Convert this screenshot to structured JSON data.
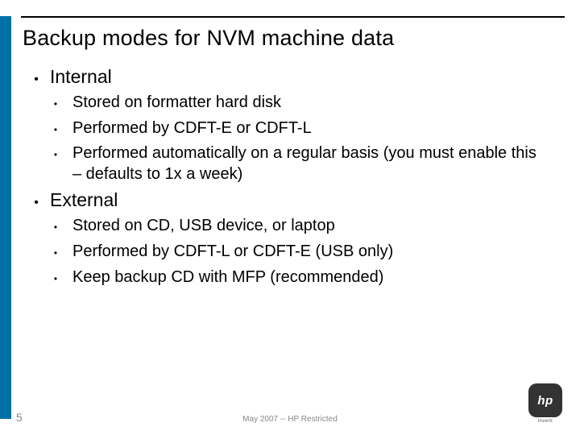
{
  "title": "Backup modes for NVM machine data",
  "sections": [
    {
      "heading": "Internal",
      "items": [
        "Stored on formatter hard disk",
        "Performed by CDFT-E or CDFT-L",
        "Performed automatically on a regular basis (you must enable this – defaults to 1x a week)"
      ]
    },
    {
      "heading": "External",
      "items": [
        "Stored on CD, USB device, or laptop",
        "Performed by CDFT-L or CDFT-E (USB only)",
        "Keep backup CD with MFP (recommended)"
      ]
    }
  ],
  "page_number": "5",
  "footer": "May 2007  --  HP Restricted",
  "logo": {
    "text": "hp",
    "tagline": "invent"
  }
}
